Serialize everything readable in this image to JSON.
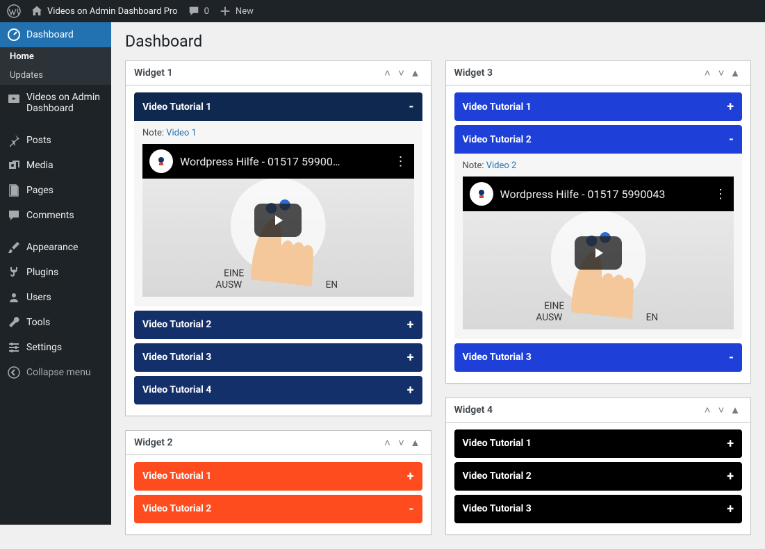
{
  "adminbar": {
    "site_name": "Videos on Admin Dashboard Pro",
    "comments_count": "0",
    "new_label": "New"
  },
  "sidebar": {
    "dashboard": "Dashboard",
    "home": "Home",
    "updates": "Updates",
    "videos": "Videos on Admin Dashboard",
    "posts": "Posts",
    "media": "Media",
    "pages": "Pages",
    "comments": "Comments",
    "appearance": "Appearance",
    "plugins": "Plugins",
    "users": "Users",
    "tools": "Tools",
    "settings": "Settings",
    "collapse": "Collapse menu"
  },
  "page": {
    "title": "Dashboard"
  },
  "widgets": [
    {
      "title": "Widget 1",
      "theme": "navy",
      "items": [
        {
          "label": "Video Tutorial 1",
          "expanded": true,
          "note_prefix": "Note: ",
          "note_link": "Video 1",
          "video_title": "Wordpress Hilfe - 01517 59900…"
        },
        {
          "label": "Video Tutorial 2",
          "expanded": false
        },
        {
          "label": "Video Tutorial 3",
          "expanded": false
        },
        {
          "label": "Video Tutorial 4",
          "expanded": false
        }
      ]
    },
    {
      "title": "Widget 2",
      "theme": "orange",
      "items": [
        {
          "label": "Video Tutorial 1",
          "expanded": false,
          "toggle": "+"
        },
        {
          "label": "Video Tutorial 2",
          "expanded": false,
          "toggle": "-"
        }
      ]
    },
    {
      "title": "Widget 3",
      "theme": "blue",
      "items": [
        {
          "label": "Video Tutorial 1",
          "expanded": false,
          "toggle": "+"
        },
        {
          "label": "Video Tutorial 2",
          "expanded": true,
          "toggle": "-",
          "note_prefix": "Note: ",
          "note_link": "Video 2",
          "video_title": "Wordpress Hilfe - 01517 5990043"
        },
        {
          "label": "Video Tutorial 3",
          "expanded": false,
          "toggle": "-"
        }
      ]
    },
    {
      "title": "Widget 4",
      "theme": "black",
      "items": [
        {
          "label": "Video Tutorial 1",
          "expanded": false
        },
        {
          "label": "Video Tutorial 2",
          "expanded": false
        },
        {
          "label": "Video Tutorial 3",
          "expanded": false
        }
      ]
    }
  ],
  "video_subtext1": "EINE",
  "video_subtext2": "AUSW",
  "video_subtext3": "EN"
}
